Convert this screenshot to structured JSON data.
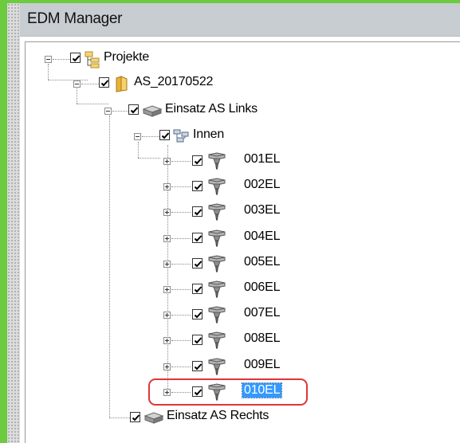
{
  "window": {
    "title": "EDM Manager"
  },
  "tree": {
    "root": {
      "label": "Projekte"
    },
    "project": {
      "label": "AS_20170522"
    },
    "insert_left": {
      "label": "Einsatz AS Links"
    },
    "inner": {
      "label": "Innen"
    },
    "items": [
      {
        "label": "001EL"
      },
      {
        "label": "002EL"
      },
      {
        "label": "003EL"
      },
      {
        "label": "004EL"
      },
      {
        "label": "005EL"
      },
      {
        "label": "006EL"
      },
      {
        "label": "007EL"
      },
      {
        "label": "008EL"
      },
      {
        "label": "009EL"
      },
      {
        "label": "010EL"
      }
    ],
    "insert_right": {
      "label": "Einsatz AS Rechts"
    }
  },
  "colors": {
    "accent_green": "#6ccb3e",
    "selection": "#3399ff",
    "highlight_ring": "#e0343b",
    "folder_yellow": "#f2c94c"
  },
  "icons": {
    "root": "tree-structure-icon",
    "project": "folder-icon",
    "insert": "gray-block-icon",
    "inner": "network-icon",
    "item": "electrode-icon"
  }
}
